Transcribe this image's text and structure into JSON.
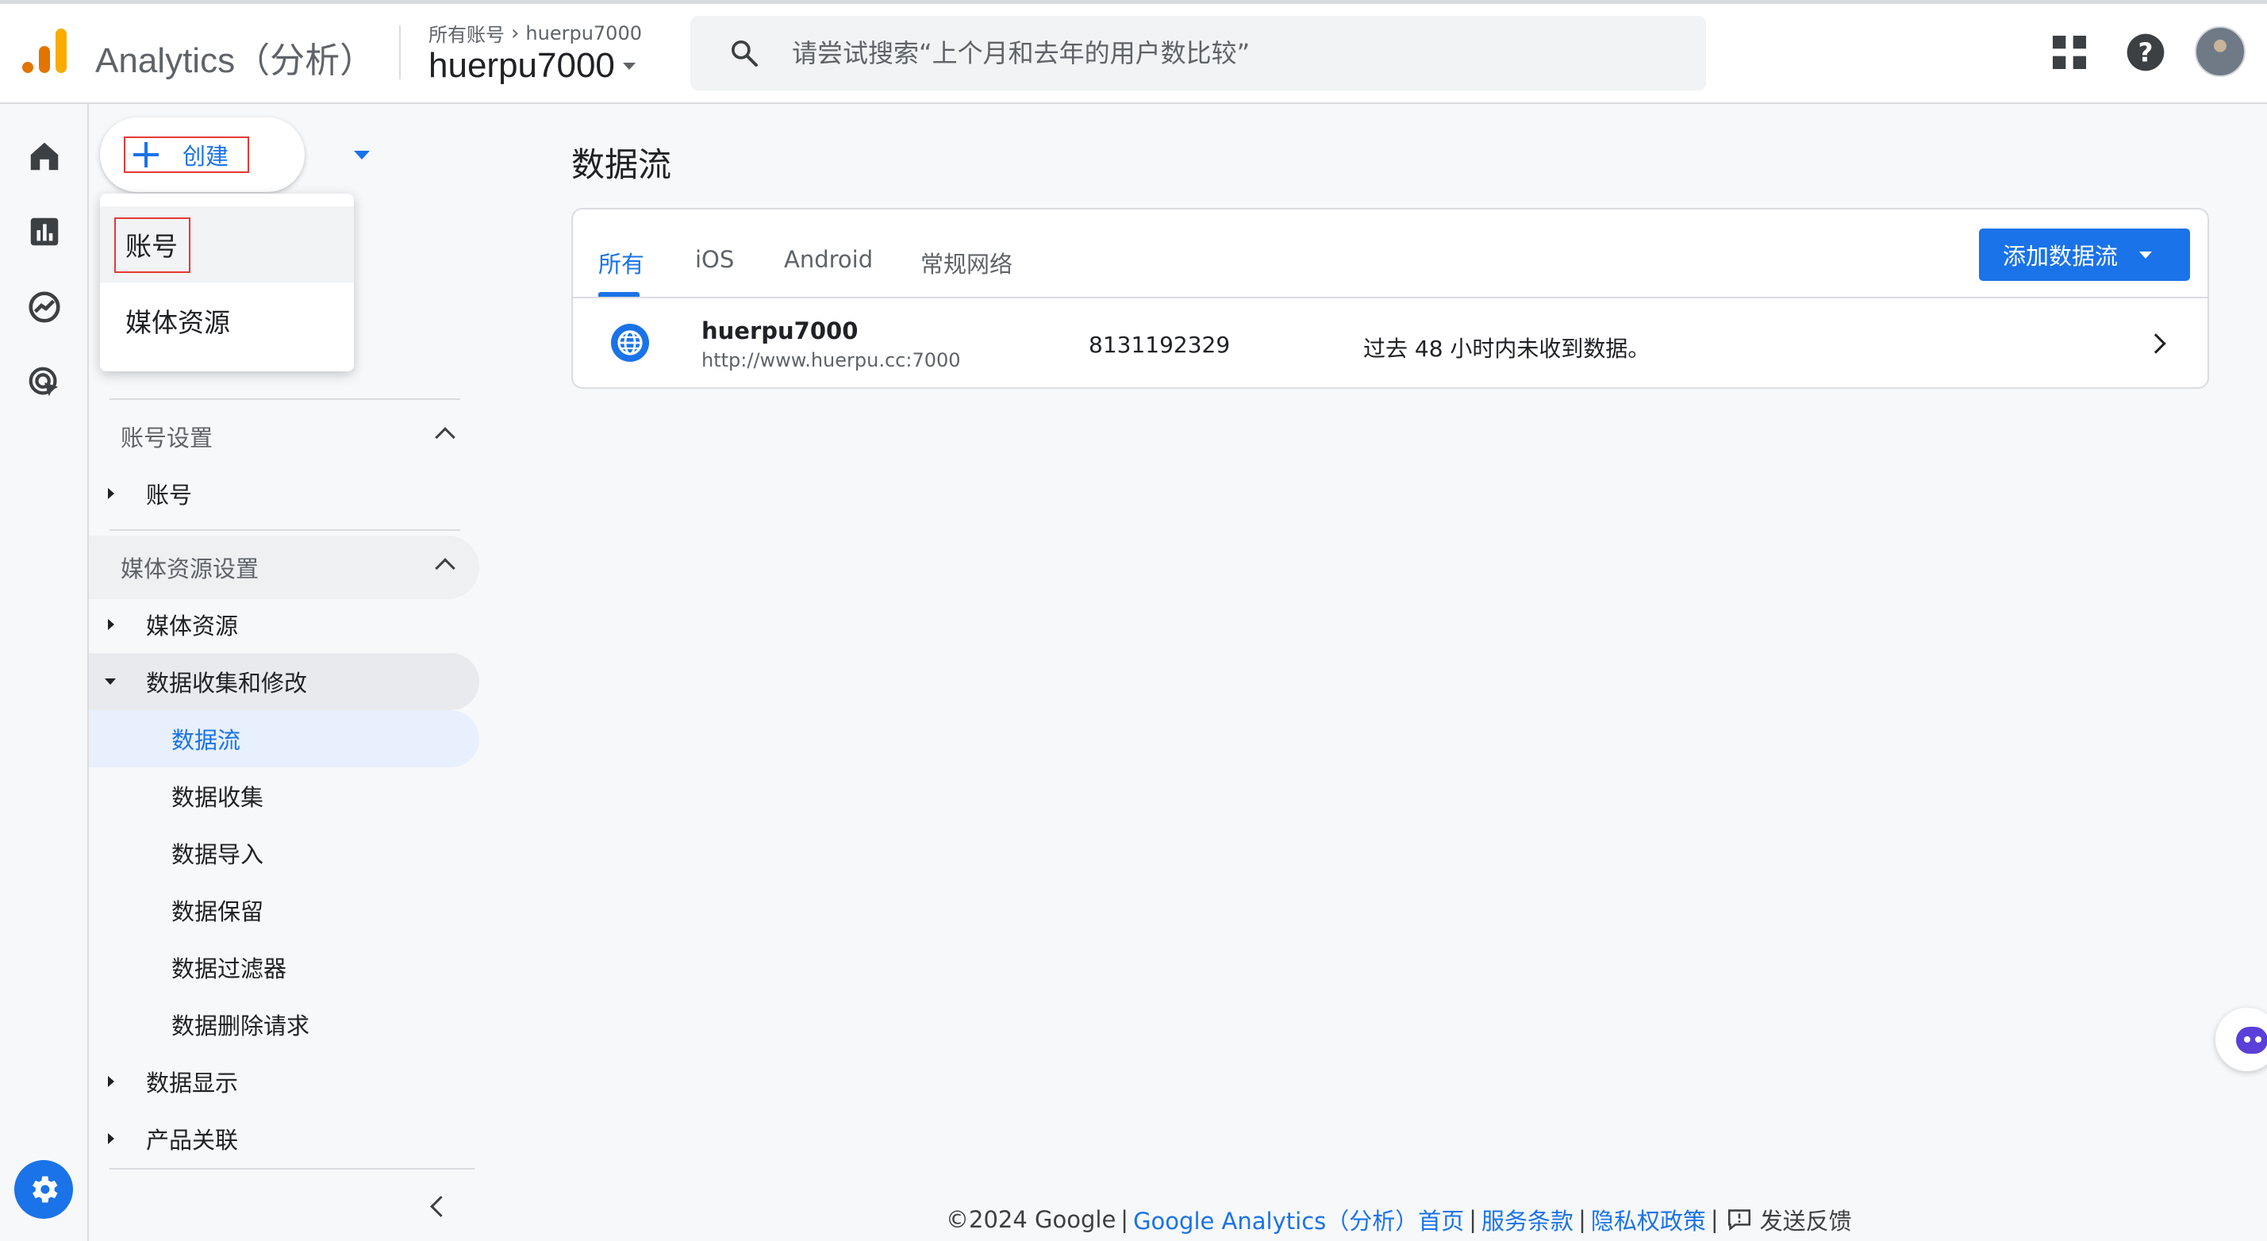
{
  "header": {
    "app_title": "Analytics（分析）",
    "breadcrumb": {
      "parent": "所有账号",
      "current": "huerpu7000"
    },
    "account_switcher": "huerpu7000",
    "search": {
      "placeholder": "请尝试搜索“上个月和去年的用户数比较”"
    },
    "icons": [
      "apps-grid-icon",
      "help-icon",
      "avatar"
    ]
  },
  "rail": {
    "icons": [
      "home-icon",
      "reports-icon",
      "explore-icon",
      "advertising-icon",
      "settings-gear-icon"
    ]
  },
  "create": {
    "label": "创建",
    "menu": [
      {
        "label": "账号",
        "highlighted": true
      },
      {
        "label": "媒体资源",
        "highlighted": false
      }
    ]
  },
  "sidebar": {
    "account_settings": {
      "title": "账号设置",
      "items": [
        {
          "label": "账号"
        }
      ]
    },
    "property_settings": {
      "title": "媒体资源设置",
      "items": [
        {
          "label": "媒体资源"
        },
        {
          "label": "数据收集和修改",
          "expanded": true,
          "children": [
            "数据流",
            "数据收集",
            "数据导入",
            "数据保留",
            "数据过滤器",
            "数据删除请求"
          ],
          "active_child": "数据流"
        },
        {
          "label": "数据显示"
        },
        {
          "label": "产品关联"
        }
      ]
    }
  },
  "main": {
    "title": "数据流",
    "tabs": [
      {
        "label": "所有",
        "active": true
      },
      {
        "label": "iOS",
        "active": false
      },
      {
        "label": "Android",
        "active": false
      },
      {
        "label": "常规网络",
        "active": false
      }
    ],
    "add_button": "添加数据流",
    "streams": [
      {
        "name": "huerpu7000",
        "url": "http://www.huerpu.cc:7000",
        "id": "8131192329",
        "status": "过去 48 小时内未收到数据。"
      }
    ]
  },
  "footer": {
    "copyright": "©2024 Google",
    "link_home": "Google Analytics（分析）首页",
    "link_terms": "服务条款",
    "link_privacy": "隐私权政策",
    "feedback": "发送反馈",
    "separator": "|"
  },
  "colors": {
    "accent": "#1a73e8",
    "highlight_box": "#e53935",
    "logo_orange": "#e37400",
    "logo_yellow": "#f9ab00"
  }
}
